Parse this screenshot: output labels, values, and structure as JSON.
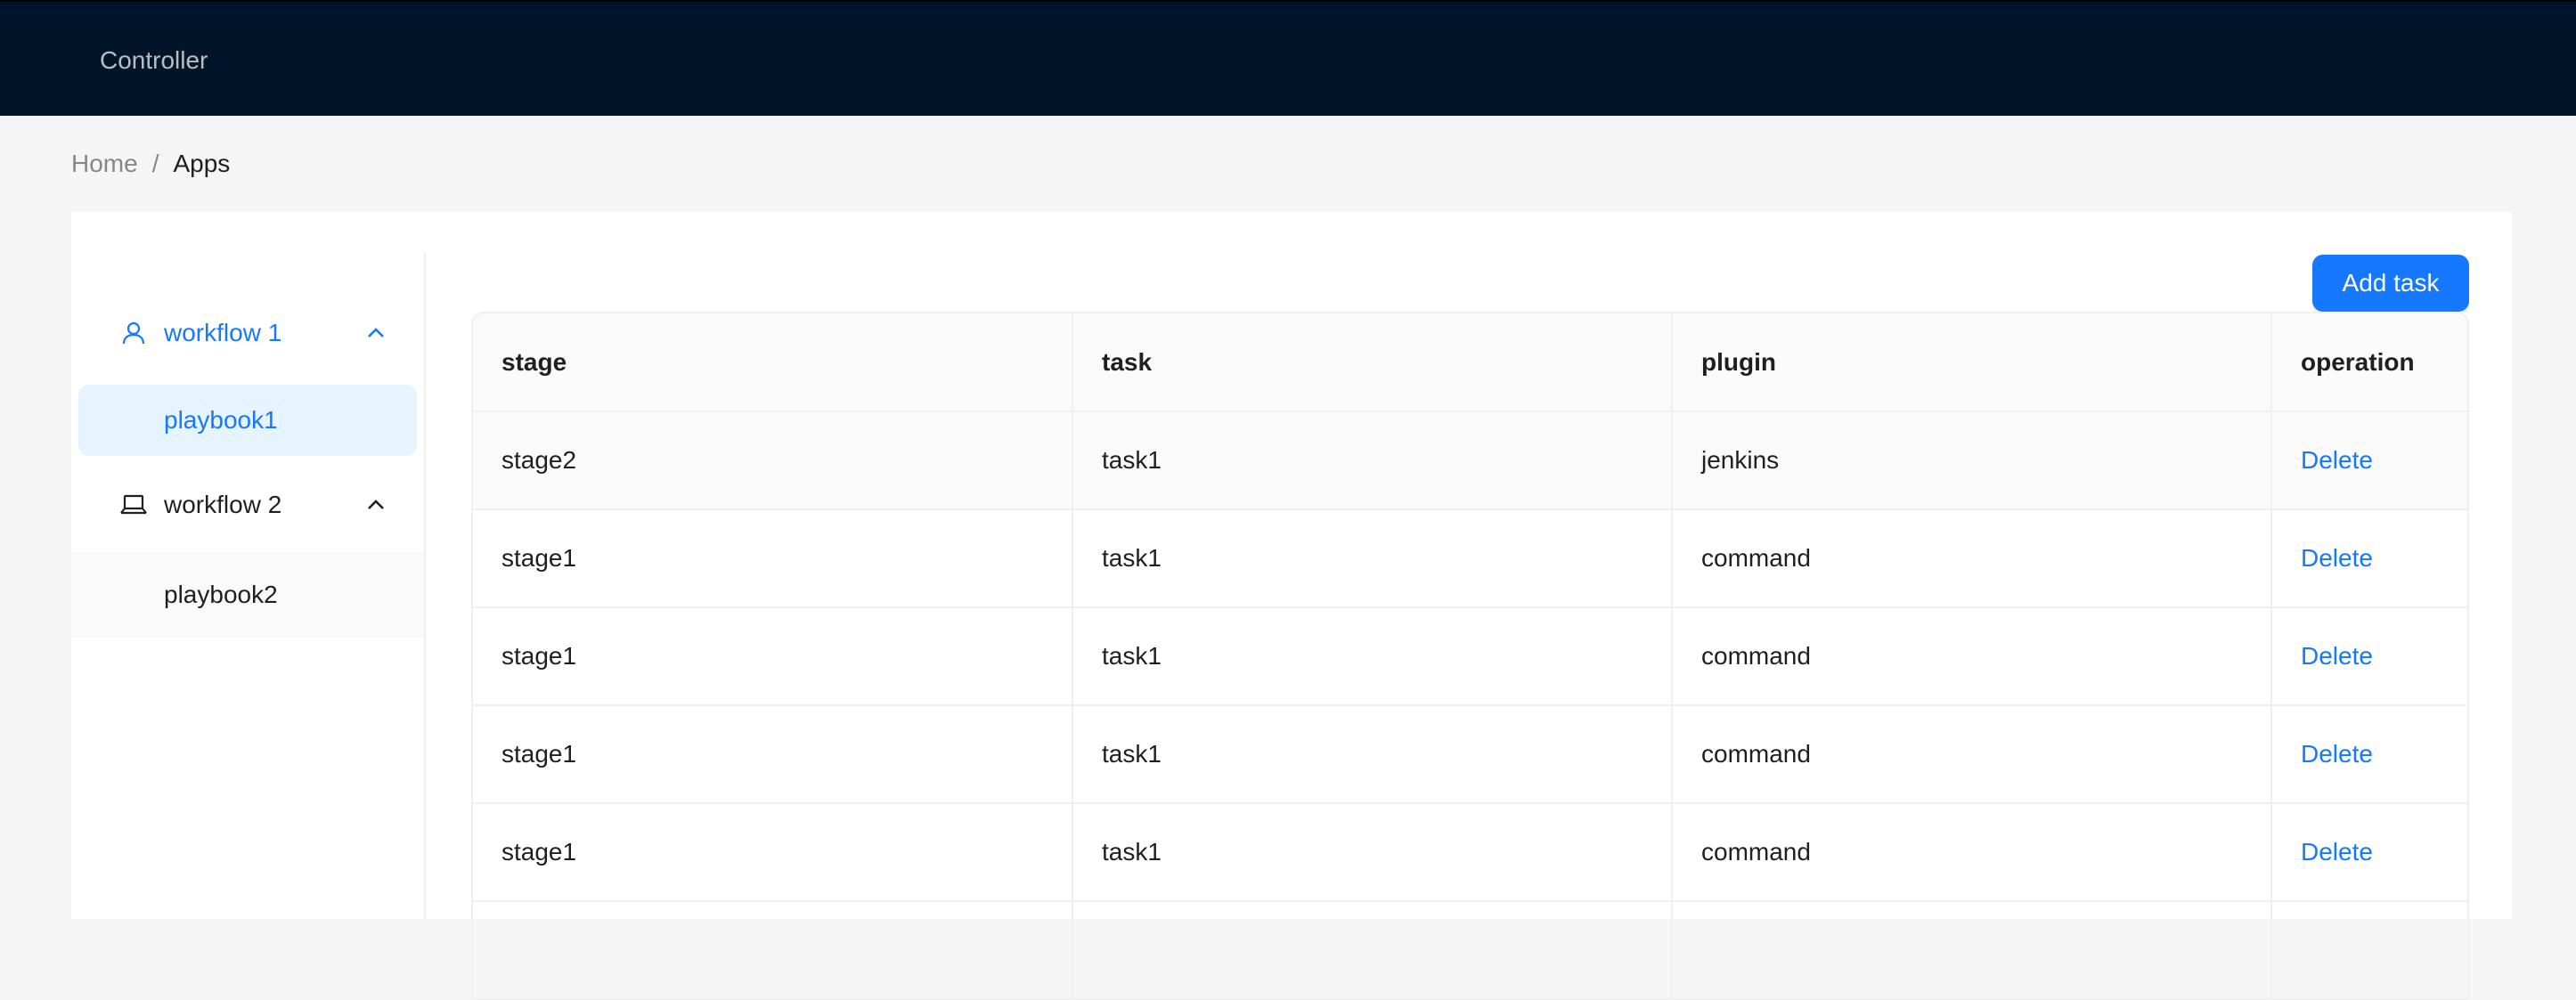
{
  "header": {
    "brand": "Controller"
  },
  "breadcrumb": {
    "home": "Home",
    "separator": "/",
    "current": "Apps"
  },
  "sidebar": {
    "groups": [
      {
        "label": "workflow 1",
        "icon": "user-icon",
        "expanded": true,
        "items": [
          {
            "label": "playbook1",
            "selected": true
          }
        ]
      },
      {
        "label": "workflow 2",
        "icon": "laptop-icon",
        "expanded": true,
        "items": [
          {
            "label": "playbook2",
            "selected": false
          }
        ]
      }
    ]
  },
  "toolbar": {
    "add_label": "Add task"
  },
  "table": {
    "columns": [
      "stage",
      "task",
      "plugin",
      "operation"
    ],
    "rows": [
      {
        "stage": "stage2",
        "task": "task1",
        "plugin": "jenkins",
        "operation": "Delete"
      },
      {
        "stage": "stage1",
        "task": "task1",
        "plugin": "command",
        "operation": "Delete"
      },
      {
        "stage": "stage1",
        "task": "task1",
        "plugin": "command",
        "operation": "Delete"
      },
      {
        "stage": "stage1",
        "task": "task1",
        "plugin": "command",
        "operation": "Delete"
      },
      {
        "stage": "stage1",
        "task": "task1",
        "plugin": "command",
        "operation": "Delete"
      },
      {
        "stage": "",
        "task": "",
        "plugin": "",
        "operation": ""
      }
    ]
  },
  "colors": {
    "header_bg": "#001529",
    "primary": "#1677ff",
    "selected_bg": "#e6f4ff",
    "page_bg": "#f5f5f5"
  }
}
